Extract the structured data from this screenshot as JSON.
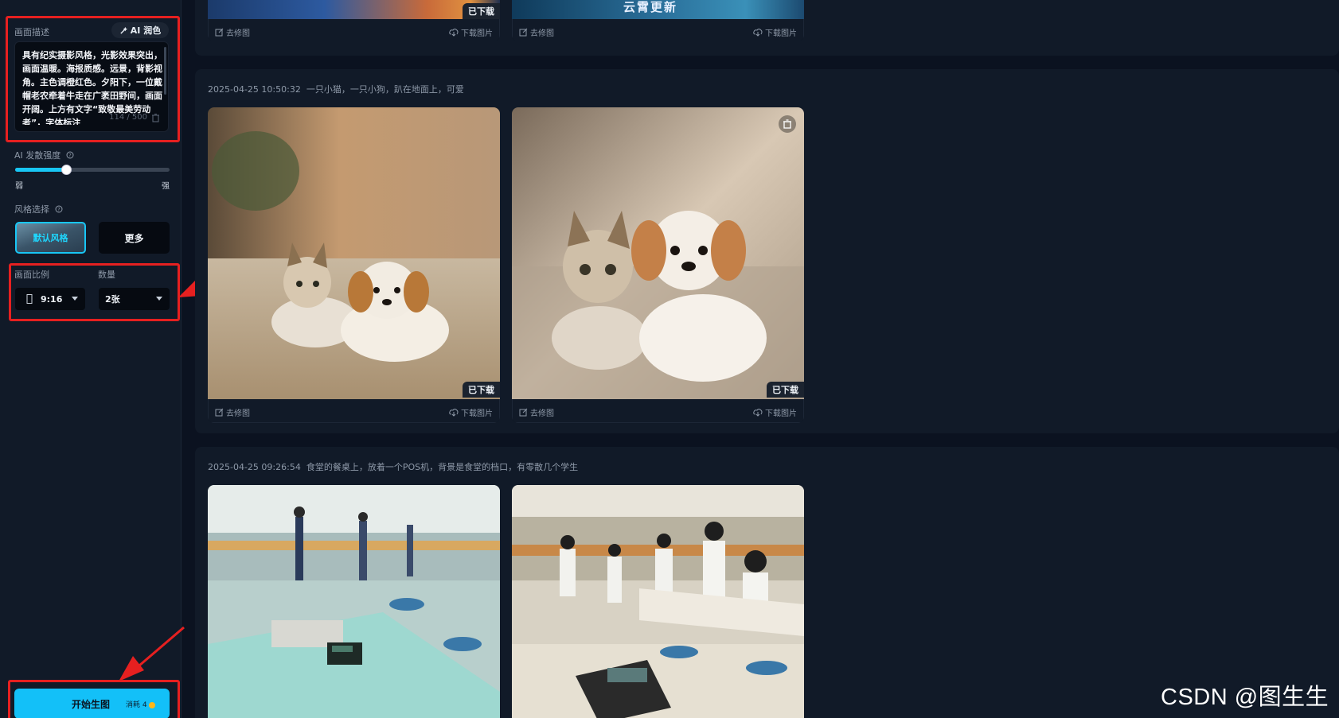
{
  "sidebar": {
    "description_label": "画面描述",
    "ai_color_label": "AI 润色",
    "description_text": "具有纪实摄影风格，光影效果突出，画面温暖。海报质感。远景，背影视角。主色调橙红色。夕阳下，一位戴帽老农牵着牛走在广袤田野间，画面开阔。上方有文字“致敬最美劳动者”，字体标注",
    "description_count": "114 / 500",
    "strength_label": "AI 发散强度",
    "strength_value": 0.33,
    "strength_min_label": "弱",
    "strength_max_label": "强",
    "style_label": "风格选择",
    "style_selected": "默认风格",
    "style_more": "更多",
    "ratio_label": "画面比例",
    "ratio_value": "9:16",
    "count_label": "数量",
    "count_value": "2张",
    "generate_label": "开始生图",
    "generate_cost": "消耗 4"
  },
  "common": {
    "retouch_label": "去修图",
    "download_label": "下载图片",
    "downloaded_badge": "已下载"
  },
  "top_banner": {
    "right_text": "云霄更新"
  },
  "groups": [
    {
      "timestamp": "2025-04-25 10:50:32",
      "prompt": "一只小猫，一只小狗，趴在地面上，可爱"
    },
    {
      "timestamp": "2025-04-25 09:26:54",
      "prompt": "食堂的餐桌上，放着一个POS机，背景是食堂的档口，有零散几个学生"
    }
  ],
  "watermark": "CSDN @图生生",
  "colors": {
    "accent": "#13c0f8",
    "annotation_red": "#e62020",
    "background": "#0b1220",
    "panel": "#111a28"
  }
}
